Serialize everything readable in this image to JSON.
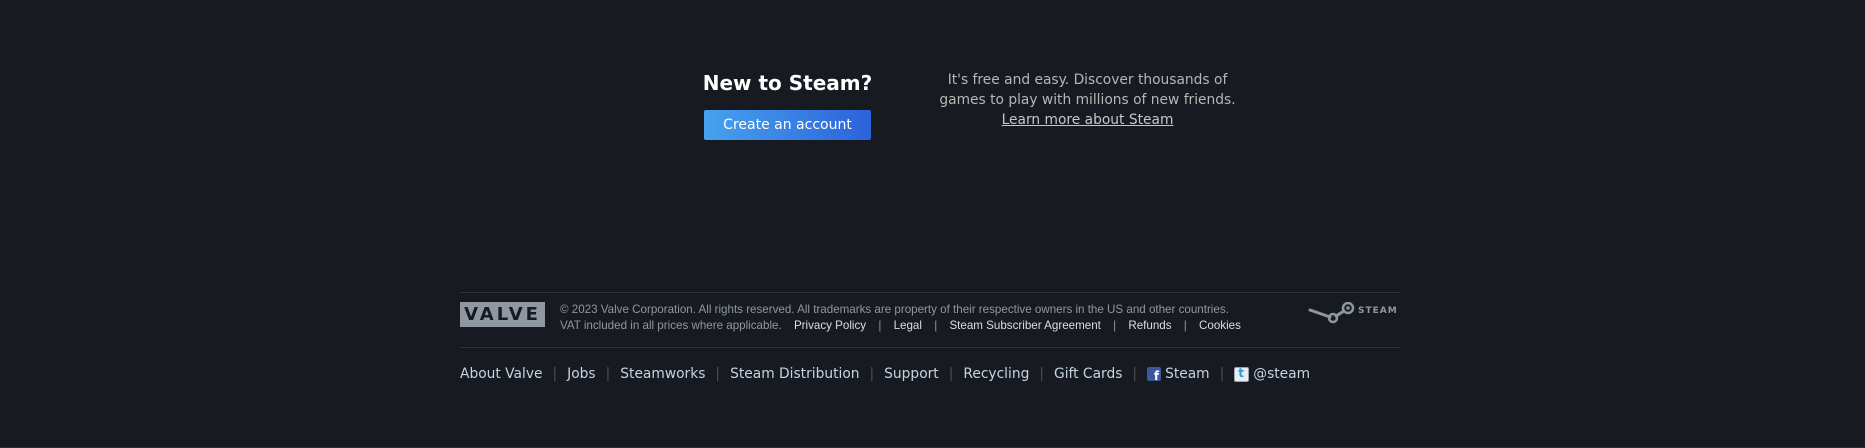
{
  "signup": {
    "title": "New to Steam?",
    "create_button_label": "Create an account",
    "description_line1": "It's free and easy. Discover thousands of",
    "description_line2": "games to play with millions of new friends.",
    "learn_more_link": "Learn more about Steam"
  },
  "footer": {
    "valve_logo_text": "VALVE",
    "steam_logo_text": "STEAM",
    "copyright": "© 2023 Valve Corporation. All rights reserved. All trademarks are property of their respective owners in the US and other countries.",
    "vat_text": "VAT included in all prices where applicable.",
    "legal_links": [
      "Privacy Policy",
      "Legal",
      "Steam Subscriber Agreement",
      "Refunds",
      "Cookies"
    ],
    "separator": "|",
    "nav_links": [
      "About Valve",
      "Jobs",
      "Steamworks",
      "Steam Distribution",
      "Support",
      "Recycling",
      "Gift Cards"
    ],
    "facebook_label": "Steam",
    "twitter_label": "@steam"
  },
  "colors": {
    "background": "#171a21",
    "button_gradient_start": "#47a2ef",
    "button_gradient_end": "#2b63d9",
    "muted_text": "#8f98a0",
    "link_text": "#dcdedf"
  },
  "icons": [
    "steam-logo-icon",
    "facebook-icon",
    "twitter-icon"
  ]
}
